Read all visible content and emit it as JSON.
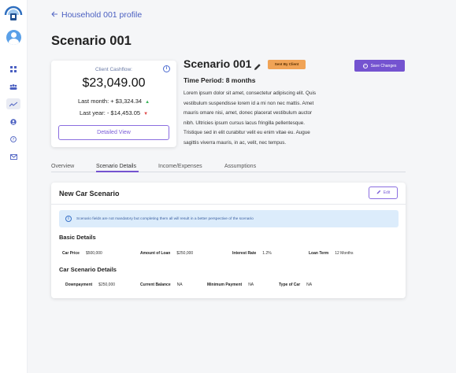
{
  "nav": {
    "back_label": "Household 001 profile",
    "page_title": "Scenario 001"
  },
  "sidebar": {
    "items": [
      {
        "icon": "dashboard-icon"
      },
      {
        "icon": "people-icon"
      },
      {
        "icon": "trend-icon",
        "active": true
      },
      {
        "icon": "account-icon"
      },
      {
        "icon": "help-icon"
      },
      {
        "icon": "mail-icon"
      }
    ]
  },
  "cashflow": {
    "label": "Client Cashflow:",
    "amount": "$23,049.00",
    "last_month": "Last month: + $3,324.34",
    "last_year": "Last year: - $14,453.05",
    "details_button": "Detailed View"
  },
  "scenario": {
    "title": "Scenario 001",
    "badge": "Sent By Client",
    "save_button": "Save Changes",
    "period": "Time Period: 8 months",
    "description_lines": [
      "Lorem ipsum dolor sit amet, consectetur adipiscing elit. Quis",
      "vestibulum suspendisse lorem id a mi non nec mattis. Amet",
      "mauris omare nisi, amet, donec placerat vestibulum auctor",
      "nibh. Ultricies ipsum cursus lacus fringilla pellentesque.",
      "Tristique sed in elit curabitur velit eu enim vitae eu. Augue",
      "sagittis viverra mauris, in ac, velit, nec tempus."
    ]
  },
  "tabs": [
    "Overview",
    "Scenario Details",
    "Income/Expenses",
    "Assumptions"
  ],
  "card": {
    "title": "New Car Scenario",
    "edit_button": "Edit",
    "info_text": "Scenario fields are not mandatory but completing them all will result in a better perspective of the scenario",
    "basic_title": "Basic Details",
    "basic_fields": [
      {
        "label": "Car Price",
        "value": "$500,000"
      },
      {
        "label": "Amount of Loan",
        "value": "$250,000"
      },
      {
        "label": "Interest Rate",
        "value": "1.2%"
      },
      {
        "label": "Loan Term",
        "value": "12 Months"
      }
    ],
    "car_title": "Car Scenario Details",
    "car_fields": [
      {
        "label": "Downpayment",
        "value": "$250,000"
      },
      {
        "label": "Current Balance",
        "value": "NA"
      },
      {
        "label": "Minimum Payment",
        "value": "NA"
      },
      {
        "label": "Type of Car",
        "value": "NA"
      }
    ]
  },
  "colors": {
    "accent": "#7453d0",
    "badge": "#f0a356",
    "link": "#4a5fc1",
    "info_bg": "#dcecfb"
  }
}
